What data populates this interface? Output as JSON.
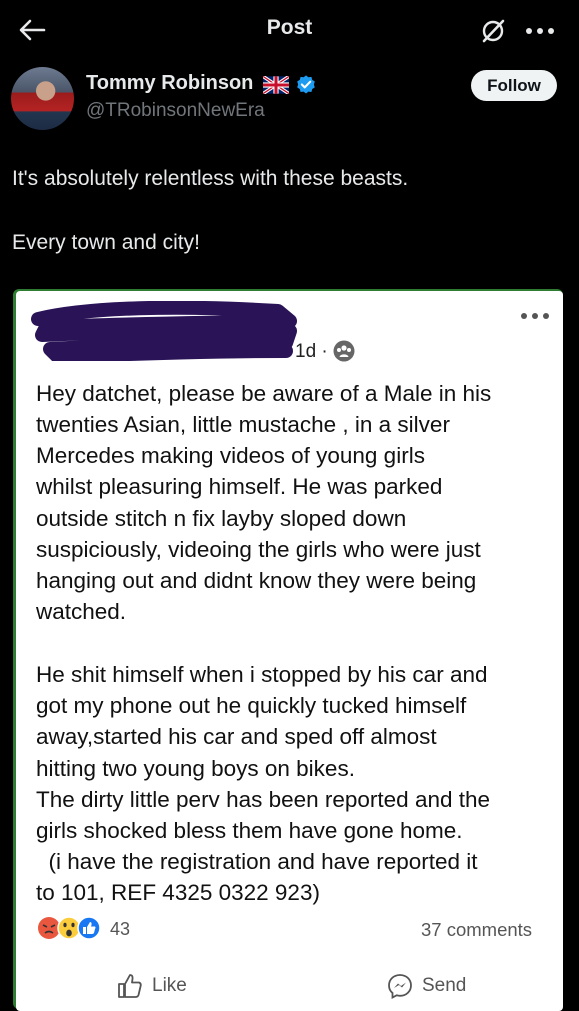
{
  "topbar": {
    "title": "Post"
  },
  "author": {
    "name": "Tommy Robinson",
    "handle": "@TRobinsonNewEra",
    "follow_label": "Follow"
  },
  "post": {
    "line1": "It's absolutely relentless with these beasts.",
    "line2": "Every town and city!"
  },
  "embed": {
    "time": "1d ·",
    "lines": [
      "Hey datchet, please be aware of a Male in his",
      "twenties Asian, little mustache , in a silver",
      "Mercedes making videos of young girls",
      "whilst pleasuring himself. He was parked",
      "outside stitch n fix layby sloped down",
      "suspiciously, videoing the girls who were just",
      "hanging out and didnt know they were being",
      "watched.",
      "He shit himself when i stopped by his car and",
      "got my phone out he quickly tucked himself",
      "away,started his car and sped off almost",
      "hitting two young boys on bikes.",
      "The dirty little perv has been reported and the",
      "girls shocked bless them have gone home.",
      "  (i have the registration and have reported it",
      "to 101, REF 4325 0322 923)"
    ],
    "reaction_count": "43",
    "comments": "37 comments",
    "like_label": "Like",
    "send_label": "Send"
  },
  "colors": {
    "background": "#000000",
    "text": "#e7e9ea",
    "muted": "#71767b",
    "verified": "#1d9bf0",
    "embed_border": "#2e7d32",
    "redaction": "#2a1457"
  }
}
